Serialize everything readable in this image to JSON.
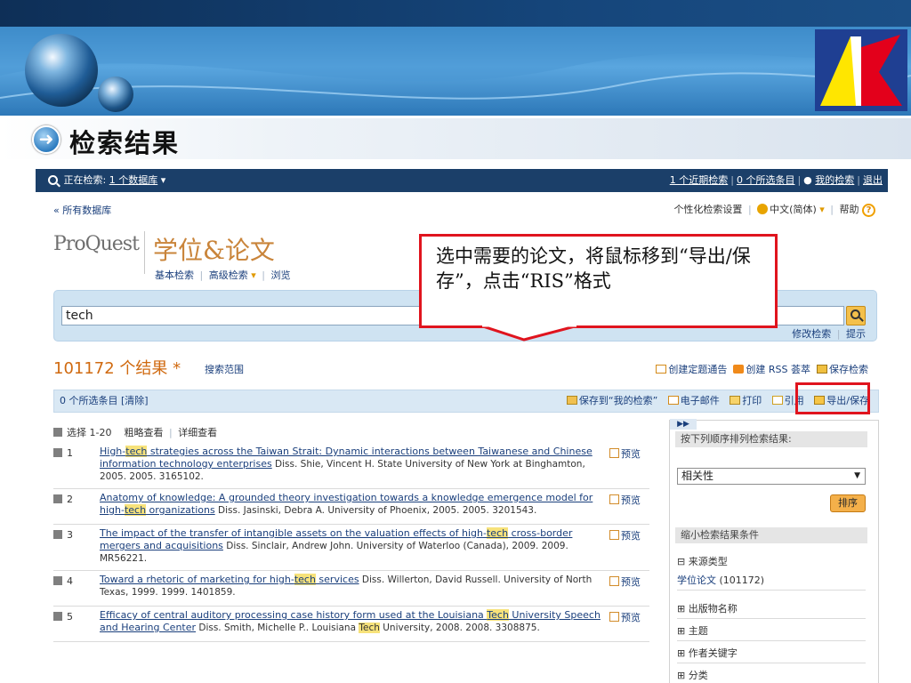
{
  "slide": {
    "title": "检索结果",
    "title_icon": "arrow-right-circle-icon"
  },
  "topbar": {
    "searching_label": "正在检索:",
    "database_link": "1 个数据库",
    "recent_search": "1 个近期检索",
    "selected_items": "0 个所选条目",
    "my_search": "我的检索",
    "logout": "退出"
  },
  "subheader": {
    "all_databases": "« 所有数据库",
    "personalize": "个性化检索设置",
    "language": "中文(简体)",
    "help": "帮助"
  },
  "brand": {
    "logo_text": "ProQuest",
    "product": "学位&论文",
    "nav": [
      "基本检索",
      "高级检索",
      "浏览"
    ]
  },
  "search": {
    "query": "tech",
    "modify": "修改检索",
    "tips": "提示"
  },
  "results_header": {
    "count": "101172 个结果 *",
    "scope": "搜索范围",
    "create_alert": "创建定题通告",
    "create_rss": "创建 RSS 荟萃",
    "save_search": "保存检索"
  },
  "toolbar": {
    "selected": "0 个所选条目 [清除]",
    "save_to_my": "保存到“我的检索”",
    "email": "电子邮件",
    "print": "打印",
    "cite": "引用",
    "export": "导出/保存"
  },
  "view": {
    "select_range": "选择 1-20",
    "brief": "粗略查看",
    "detailed": "详细查看"
  },
  "results": [
    {
      "num": "1",
      "title_before": "High-",
      "title_hl": "tech",
      "title_after": " strategies across the Taiwan Strait: Dynamic interactions between Taiwanese and Chinese information technology enterprises",
      "meta_before": " Diss. Shie, Vincent H. State University of New York at Binghamton, 2005. 2005. 3165102.",
      "meta_hl": "",
      "meta_after": "",
      "preview": "预览"
    },
    {
      "num": "2",
      "title_before": "Anatomy of knowledge: A grounded theory investigation towards a knowledge emergence model for high-",
      "title_hl": "tech",
      "title_after": " organizations",
      "meta_before": " Diss. Jasinski, Debra A. University of Phoenix, 2005. 2005. 3201543.",
      "meta_hl": "",
      "meta_after": "",
      "preview": "预览"
    },
    {
      "num": "3",
      "title_before": "The impact of the transfer of intangible assets on the valuation effects of high-",
      "title_hl": "tech",
      "title_after": " cross-border mergers and acquisitions",
      "meta_before": " Diss. Sinclair, Andrew John. University of Waterloo (Canada), 2009. 2009. MR56221.",
      "meta_hl": "",
      "meta_after": "",
      "preview": "预览"
    },
    {
      "num": "4",
      "title_before": "Toward a rhetoric of marketing for high-",
      "title_hl": "tech",
      "title_after": " services",
      "meta_before": " Diss. Willerton, David Russell. University of North Texas, 1999. 1999. 1401859.",
      "meta_hl": "",
      "meta_after": "",
      "preview": "预览"
    },
    {
      "num": "5",
      "title_before": "Efficacy of central auditory processing case history form used at the Louisiana ",
      "title_hl": "Tech",
      "title_after": " University Speech and Hearing Center",
      "meta_before": " Diss. Smith, Michelle P.. Louisiana ",
      "meta_hl": "Tech",
      "meta_after": " University, 2008. 2008. 3308875.",
      "preview": "预览"
    }
  ],
  "sidebar": {
    "expander": "▶▶",
    "sort_head": "按下列顺序排列检索结果:",
    "sort_value": "相关性",
    "sort_button": "排序",
    "narrow_head": "缩小检索结果条件",
    "facet_source": "⊟ 来源类型",
    "facet_source_value": "学位论文",
    "facet_source_count": "(101172)",
    "facet_pub": "⊞ 出版物名称",
    "facet_subject": "⊞ 主题",
    "facet_author_kw": "⊞ 作者关键字",
    "facet_class": "⊞ 分类"
  },
  "callout": {
    "text": "选中需要的论文，将鼠标移到“导出/保存”，点击“RIS”格式"
  },
  "colors": {
    "accent_red": "#e0141e",
    "nav_blue": "#1b3f69",
    "link_blue": "#1a3f7c",
    "result_orange": "#d06a10",
    "highlight_yellow": "#f7e27a"
  }
}
